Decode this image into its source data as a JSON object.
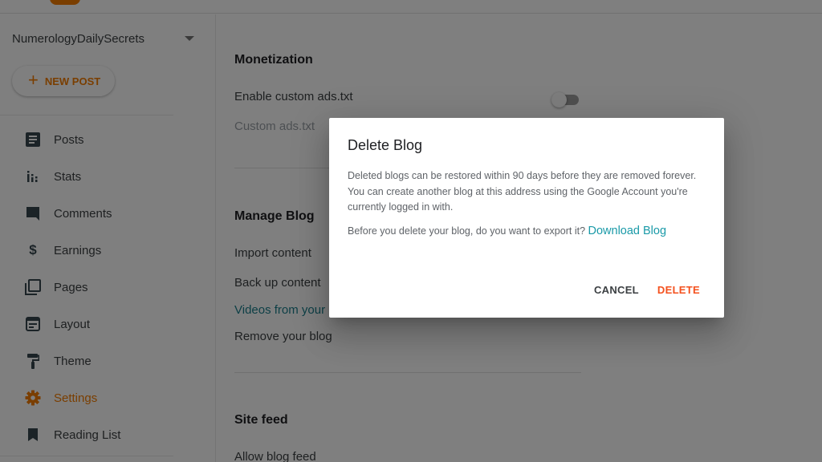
{
  "header": {
    "logo": "blogger-logo"
  },
  "sidebar": {
    "blog_name": "NumerologyDailySecrets",
    "blog_select_icon": "caret-down-icon",
    "new_post": {
      "icon": "plus-icon",
      "plus": "+",
      "label": "NEW POST"
    },
    "items": [
      {
        "label": "Posts",
        "icon": "posts-icon",
        "active": false
      },
      {
        "label": "Stats",
        "icon": "stats-icon",
        "active": false
      },
      {
        "label": "Comments",
        "icon": "comment-icon",
        "active": false
      },
      {
        "label": "Earnings",
        "icon": "dollar-icon",
        "active": false
      },
      {
        "label": "Pages",
        "icon": "pages-icon",
        "active": false
      },
      {
        "label": "Layout",
        "icon": "layout-icon",
        "active": false
      },
      {
        "label": "Theme",
        "icon": "paint-roller-icon",
        "active": false
      },
      {
        "label": "Settings",
        "icon": "gear-icon",
        "active": true
      },
      {
        "label": "Reading List",
        "icon": "bookmark-icon",
        "active": false
      }
    ]
  },
  "main": {
    "monetization": {
      "title": "Monetization",
      "enable_custom_ads": "Enable custom ads.txt",
      "enable_custom_ads_on": false,
      "custom_ads": "Custom ads.txt"
    },
    "manage_blog": {
      "title": "Manage Blog",
      "import": "Import content",
      "backup": "Back up content",
      "videos": "Videos from your",
      "remove": "Remove your blog"
    },
    "site_feed": {
      "title": "Site feed",
      "allow_feed": "Allow blog feed"
    }
  },
  "dialog": {
    "title": "Delete Blog",
    "body": "Deleted blogs can be restored within 90 days before they are removed forever. You can create another blog at this address using the Google Account you're currently logged in with.",
    "export_prompt": "Before you delete your blog, do you want to export it?",
    "download_link": "Download Blog",
    "cancel": "CANCEL",
    "delete": "DELETE"
  },
  "colors": {
    "accent": "#f57c00",
    "link": "#1a9aa8",
    "danger": "#f4511e"
  }
}
